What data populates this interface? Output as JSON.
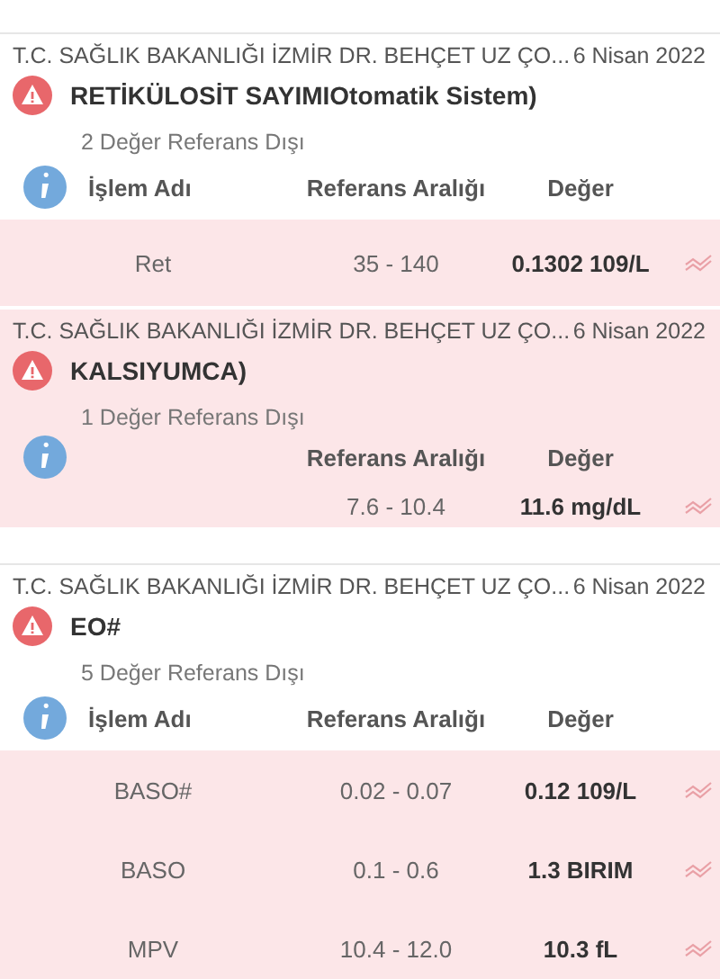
{
  "results": [
    {
      "source": "T.C. SAĞLIK BAKANLIĞI İZMİR DR. BEHÇET UZ ÇO...",
      "date": "6 Nisan 2022",
      "title": "RETİKÜLOSİT SAYIMIOtomatik Sistem)",
      "summary": "2 Değer Referans Dışı",
      "highlighted": false,
      "columns": [
        {
          "kind": "name",
          "label": "İşlem Adı"
        },
        {
          "kind": "range",
          "label": "Referans Aralığı"
        },
        {
          "kind": "value",
          "label": "Değer"
        }
      ],
      "rows": [
        {
          "name": "Ret",
          "range": "35 - 140",
          "value": "0.1302 109/L"
        }
      ]
    },
    {
      "source": "T.C. SAĞLIK BAKANLIĞI İZMİR DR. BEHÇET UZ ÇO...",
      "date": "6 Nisan 2022",
      "title": "KALSIYUMCA)",
      "summary": "1 Değer Referans Dışı",
      "highlighted": true,
      "columns": [
        {
          "kind": "range",
          "label": "Referans Aralığı"
        },
        {
          "kind": "value",
          "label": "Değer"
        }
      ],
      "rows": [
        {
          "range": "7.6 - 10.4",
          "value": "11.6 mg/dL"
        }
      ]
    },
    {
      "source": "T.C. SAĞLIK BAKANLIĞI İZMİR DR. BEHÇET UZ ÇO...",
      "date": "6 Nisan 2022",
      "title": "EO#",
      "summary": "5 Değer Referans Dışı",
      "highlighted": false,
      "columns": [
        {
          "kind": "name",
          "label": "İşlem Adı"
        },
        {
          "kind": "range",
          "label": "Referans Aralığı"
        },
        {
          "kind": "value",
          "label": "Değer"
        }
      ],
      "rows": [
        {
          "name": "BASO#",
          "range": "0.02 - 0.07",
          "value": "0.12 109/L"
        },
        {
          "name": "BASO",
          "range": "0.1 - 0.6",
          "value": "1.3 BIRIM"
        },
        {
          "name": "MPV",
          "range": "10.4 - 12.0",
          "value": "10.3 fL"
        }
      ]
    }
  ]
}
